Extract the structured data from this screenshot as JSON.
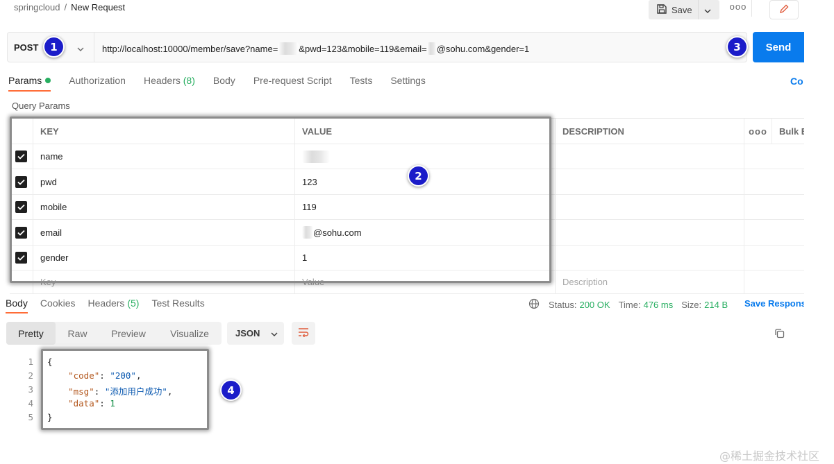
{
  "header": {
    "breadcrumb_root": "springcloud",
    "breadcrumb_sep": "/",
    "breadcrumb_current": "New Request",
    "save_label": "Save",
    "more_label": "ooo"
  },
  "request": {
    "method": "POST",
    "url_part1": "http://localhost:10000/member/save?name=",
    "url_part2": "&pwd=123&mobile=119&email=",
    "url_part3": "@sohu.com&gender=1",
    "send_label": "Send"
  },
  "annotations": {
    "badge1": "1",
    "badge2": "2",
    "badge3": "3",
    "badge4": "4"
  },
  "request_tabs": {
    "params": "Params",
    "authorization": "Authorization",
    "headers": "Headers",
    "headers_count": "(8)",
    "body": "Body",
    "prerequest": "Pre-request Script",
    "tests": "Tests",
    "settings": "Settings",
    "cookies": "Co"
  },
  "query_params": {
    "title": "Query Params",
    "columns": {
      "key": "KEY",
      "value": "VALUE",
      "description": "DESCRIPTION",
      "more": "ooo",
      "bulk": "Bulk Edit"
    },
    "rows": [
      {
        "key": "name",
        "value": ""
      },
      {
        "key": "pwd",
        "value": "123"
      },
      {
        "key": "mobile",
        "value": "119"
      },
      {
        "key": "email",
        "value": "@sohu.com"
      },
      {
        "key": "gender",
        "value": "1"
      }
    ],
    "placeholders": {
      "key": "Key",
      "value": "Value",
      "description": "Description"
    }
  },
  "response": {
    "tabs": {
      "body": "Body",
      "cookies": "Cookies",
      "headers": "Headers",
      "headers_count": "(5)",
      "test_results": "Test Results"
    },
    "status_label": "Status:",
    "status_value": "200 OK",
    "time_label": "Time:",
    "time_value": "476 ms",
    "size_label": "Size:",
    "size_value": "214 B",
    "save_response": "Save Response",
    "formats": {
      "pretty": "Pretty",
      "raw": "Raw",
      "preview": "Preview",
      "visualize": "Visualize"
    },
    "language": "JSON",
    "line_numbers": [
      "1",
      "2",
      "3",
      "4",
      "5"
    ],
    "json": {
      "open": "{",
      "code_key": "\"code\"",
      "code_val": "\"200\"",
      "msg_key": "\"msg\"",
      "msg_val": "\"添加用户成功\"",
      "data_key": "\"data\"",
      "data_val": "1",
      "close": "}"
    }
  },
  "watermark": "@稀土掘金技术社区",
  "colors": {
    "send": "#097bed",
    "accent_tab": "#ff6c37",
    "status_ok": "#27ae60",
    "badge": "#1b1cc9"
  }
}
